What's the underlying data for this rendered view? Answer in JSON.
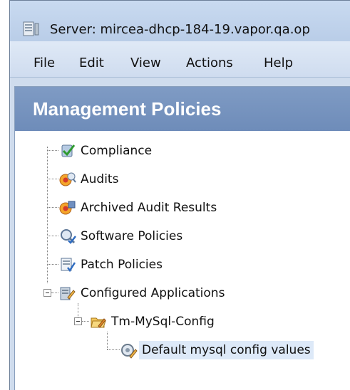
{
  "window": {
    "title": "Server: mircea-dhcp-184-19.vapor.qa.op"
  },
  "menu": [
    "File",
    "Edit",
    "View",
    "Actions",
    "Help"
  ],
  "panel": {
    "title": "Management Policies"
  },
  "tree": {
    "items": [
      {
        "label": "Compliance",
        "icon": "compliance-check-icon"
      },
      {
        "label": "Audits",
        "icon": "audit-icon"
      },
      {
        "label": "Archived Audit Results",
        "icon": "archived-audit-icon"
      },
      {
        "label": "Software Policies",
        "icon": "software-policy-icon"
      },
      {
        "label": "Patch Policies",
        "icon": "patch-policy-icon"
      },
      {
        "label": "Configured Applications",
        "icon": "configured-apps-icon"
      },
      {
        "label": "Tm-MySql-Config",
        "icon": "folder-config-icon"
      },
      {
        "label": "Default mysql config values",
        "icon": "config-values-icon"
      }
    ]
  },
  "colors": {
    "panel_header": "#7490bf",
    "selection": "#dde9f8",
    "window_frame": "#cfdced"
  }
}
